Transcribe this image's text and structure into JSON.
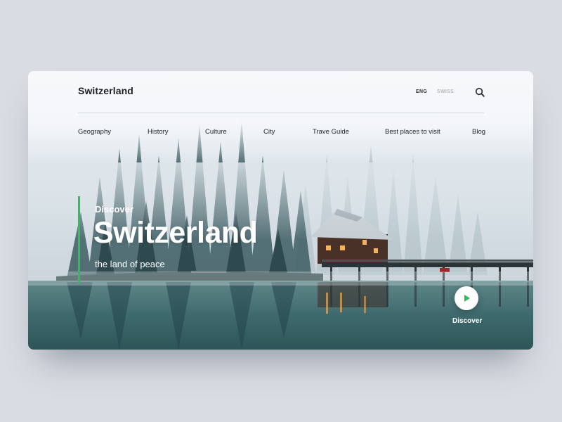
{
  "header": {
    "brand": "Switzerland",
    "languages": [
      "ENG",
      "SWISS"
    ],
    "search_icon": "search-icon"
  },
  "nav": {
    "items": [
      "Geography",
      "History",
      "Culture",
      "City",
      "Trave Guide",
      "Best places to visit",
      "Blog"
    ]
  },
  "hero": {
    "eyebrow": "Discover",
    "title": "Switzerland",
    "subtitle": "the land of peace",
    "cta_label": "Discover",
    "cta_icon": "play-icon"
  },
  "colors": {
    "accent": "#2fbf5a",
    "text_dark": "#1c1f24",
    "muted": "#b4b8be",
    "page_bg": "#d9dce2"
  }
}
